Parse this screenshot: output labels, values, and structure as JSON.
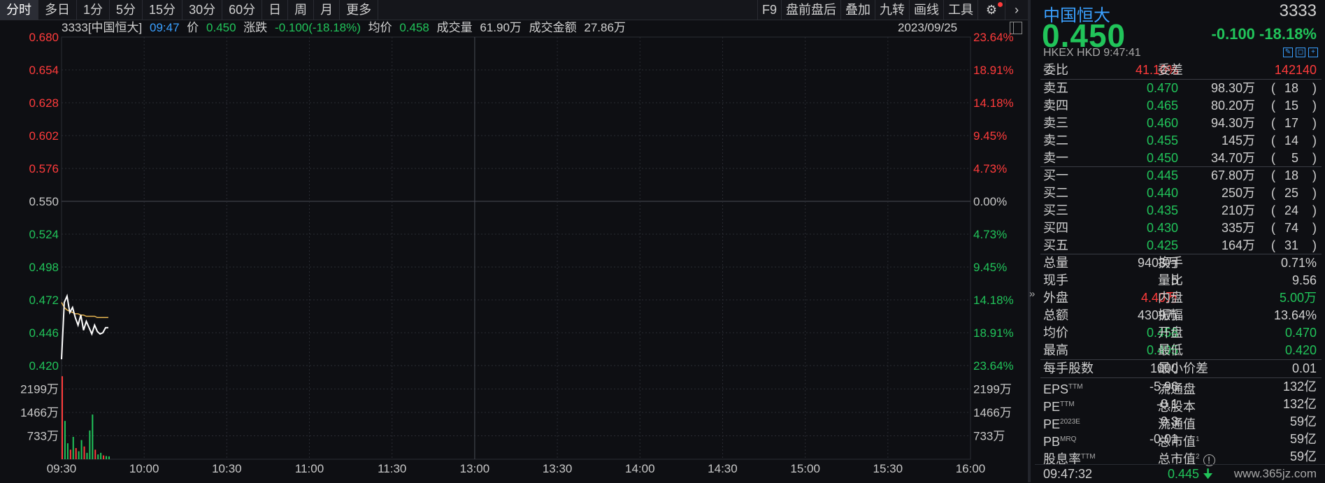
{
  "toolbar": {
    "timeframes": [
      "分时",
      "多日",
      "1分",
      "5分",
      "15分",
      "30分",
      "60分",
      "日",
      "周",
      "月",
      "更多"
    ],
    "tools": [
      "F9",
      "盘前盘后",
      "叠加",
      "九转",
      "画线",
      "工具"
    ]
  },
  "infobar": {
    "code_name": "3333[中国恒大]",
    "time": "09:47",
    "price_label": "价",
    "price": "0.450",
    "change_label": "涨跌",
    "change": "-0.100(-18.18%)",
    "avg_label": "均价",
    "avg": "0.458",
    "volume_label": "成交量",
    "volume": "61.90万",
    "amount_label": "成交金额",
    "amount": "27.86万",
    "date": "2023/09/25"
  },
  "chart_data": {
    "type": "line",
    "y_ticks": [
      "0.680",
      "0.654",
      "0.628",
      "0.602",
      "0.576",
      "0.550",
      "0.524",
      "0.498",
      "0.472",
      "0.446",
      "0.420"
    ],
    "pct_ticks": [
      "23.64%",
      "18.91%",
      "14.18%",
      "9.45%",
      "4.73%",
      "0.00%",
      "4.73%",
      "9.45%",
      "14.18%",
      "18.91%",
      "23.64%"
    ],
    "ylim": [
      0.42,
      0.68
    ],
    "prev_close": 0.55,
    "vol_ticks": [
      "2199万",
      "1466万",
      "733万"
    ],
    "x_ticks": [
      "09:30",
      "10:00",
      "10:30",
      "11:00",
      "11:30",
      "13:00",
      "13:30",
      "14:00",
      "14:30",
      "15:00",
      "15:30",
      "16:00"
    ],
    "colors": {
      "up": "#ff3b3b",
      "down": "#21c45a",
      "price_line": "#ffffff",
      "avg_line": "#e6b450",
      "grid": "#2a2c33"
    },
    "price_series": {
      "name": "价",
      "x": [
        0,
        1,
        2,
        3,
        4,
        5,
        6,
        7,
        8,
        9,
        10,
        11,
        12,
        13,
        14,
        15,
        16,
        17
      ],
      "y": [
        0.425,
        0.47,
        0.475,
        0.462,
        0.466,
        0.458,
        0.452,
        0.46,
        0.448,
        0.455,
        0.45,
        0.445,
        0.452,
        0.447,
        0.445,
        0.446,
        0.45,
        0.45
      ]
    },
    "avg_series": {
      "name": "均价",
      "x": [
        0,
        1,
        2,
        3,
        4,
        5,
        6,
        7,
        8,
        9,
        10,
        11,
        12,
        13,
        14,
        15,
        16,
        17
      ],
      "y": [
        0.47,
        0.466,
        0.464,
        0.463,
        0.462,
        0.461,
        0.461,
        0.46,
        0.46,
        0.459,
        0.459,
        0.459,
        0.459,
        0.458,
        0.458,
        0.458,
        0.458,
        0.458
      ]
    },
    "volume_series": {
      "name": "成交量",
      "x": [
        0,
        1,
        2,
        3,
        4,
        5,
        6,
        7,
        8,
        9,
        10,
        11,
        12,
        13,
        14,
        15,
        16,
        17
      ],
      "values": [
        2600,
        1200,
        500,
        300,
        700,
        350,
        250,
        600,
        400,
        200,
        900,
        1400,
        300,
        150,
        200,
        120,
        100,
        90
      ],
      "dir": [
        "up",
        "down",
        "down",
        "up",
        "down",
        "up",
        "down",
        "down",
        "up",
        "down",
        "down",
        "down",
        "up",
        "down",
        "down",
        "up",
        "down",
        "down"
      ]
    }
  },
  "quote": {
    "name": "中国恒大",
    "code": "3333",
    "price": "0.450",
    "change": "-0.100",
    "change_pct": "-18.18%",
    "exchange": "HKEX",
    "currency": "HKD",
    "time": "9:47:41",
    "weibi_label": "委比",
    "weibi": "41.10%",
    "weicha_label": "委差",
    "weicha": "142140",
    "asks": [
      {
        "label": "卖五",
        "price": "0.470",
        "vol": "98.30万",
        "count": "18"
      },
      {
        "label": "卖四",
        "price": "0.465",
        "vol": "80.20万",
        "count": "15"
      },
      {
        "label": "卖三",
        "price": "0.460",
        "vol": "94.30万",
        "count": "17"
      },
      {
        "label": "卖二",
        "price": "0.455",
        "vol": "145万",
        "count": "14"
      },
      {
        "label": "卖一",
        "price": "0.450",
        "vol": "34.70万",
        "count": "5"
      }
    ],
    "bids": [
      {
        "label": "买一",
        "price": "0.445",
        "vol": "67.80万",
        "count": "18"
      },
      {
        "label": "买二",
        "price": "0.440",
        "vol": "250万",
        "count": "25"
      },
      {
        "label": "买三",
        "price": "0.435",
        "vol": "210万",
        "count": "24"
      },
      {
        "label": "买四",
        "price": "0.430",
        "vol": "335万",
        "count": "74"
      },
      {
        "label": "买五",
        "price": "0.425",
        "vol": "164万",
        "count": "31"
      }
    ],
    "stats": [
      {
        "l1": "总量",
        "v1": "9403万",
        "c1": "white",
        "l2": "换手",
        "v2": "0.71%",
        "c2": "white"
      },
      {
        "l1": "现手",
        "v1": "5",
        "c1": "white",
        "l2": "量比",
        "v2": "9.56",
        "c2": "white"
      },
      {
        "l1": "外盘",
        "v1": "4.40万",
        "c1": "red",
        "l2": "内盘",
        "v2": "5.00万",
        "c2": "green"
      },
      {
        "l1": "总额",
        "v1": "4309万",
        "c1": "white",
        "l2": "振幅",
        "v2": "13.64%",
        "c2": "white"
      },
      {
        "l1": "均价",
        "v1": "0.458",
        "c1": "green",
        "l2": "开盘",
        "v2": "0.470",
        "c2": "green"
      },
      {
        "l1": "最高",
        "v1": "0.495",
        "c1": "green",
        "l2": "最低",
        "v2": "0.420",
        "c2": "green"
      }
    ],
    "lot_label": "每手股数",
    "lot": "1000",
    "tick_label": "最小价差",
    "tick": "0.01",
    "fund": [
      {
        "l1": "EPS",
        "s1": "TTM",
        "v1": "-5.96",
        "l2": "流通盘",
        "s2": "",
        "v2": "132亿"
      },
      {
        "l1": "PE",
        "s1": "TTM",
        "v1": "-0.1",
        "l2": "总股本",
        "s2": "",
        "v2": "132亿"
      },
      {
        "l1": "PE",
        "s1": "2023E",
        "v1": "0.3",
        "l2": "流通值",
        "s2": "",
        "v2": "59亿"
      },
      {
        "l1": "PB",
        "s1": "MRQ",
        "v1": "-0.01",
        "l2": "总市值",
        "s2": "1",
        "v2": "59亿"
      },
      {
        "l1": "股息率",
        "s1": "TTM",
        "v1": "-",
        "l2": "总市值",
        "s2": "2",
        "v2": "59亿"
      }
    ]
  },
  "bottom": {
    "time": "09:47:32",
    "price": "0.445",
    "watermark": "www.365jz.com"
  }
}
